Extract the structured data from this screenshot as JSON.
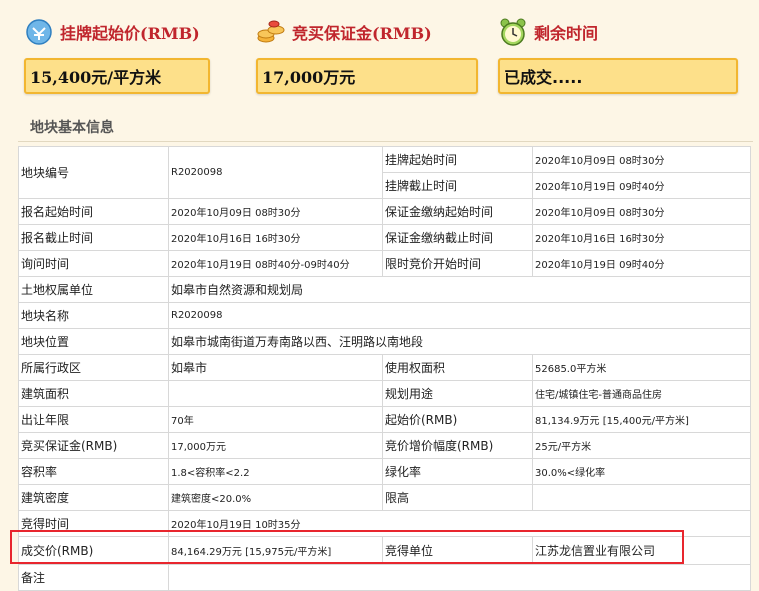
{
  "top": {
    "start_price_label": "挂牌起始价(RMB)",
    "start_price_value": "15,400元/平方米",
    "deposit_label": "竞买保证金(RMB)",
    "deposit_value": "17,000万元",
    "remaining_label": "剩余时间",
    "remaining_value": "已成交....."
  },
  "section_title": "地块基本信息",
  "rows": {
    "r1": {
      "l1": "地块编号",
      "v1": "R2020098",
      "l2a": "挂牌起始时间",
      "v2a": "2020年10月09日 08时30分",
      "l2b": "挂牌截止时间",
      "v2b": "2020年10月19日 09时40分"
    },
    "r2": {
      "l1": "报名起始时间",
      "v1": "2020年10月09日 08时30分",
      "l2": "保证金缴纳起始时间",
      "v2": "2020年10月09日 08时30分"
    },
    "r3": {
      "l1": "报名截止时间",
      "v1": "2020年10月16日 16时30分",
      "l2": "保证金缴纳截止时间",
      "v2": "2020年10月16日 16时30分"
    },
    "r4": {
      "l1": "询问时间",
      "v1": "2020年10月19日 08时40分-09时40分",
      "l2": "限时竞价开始时间",
      "v2": "2020年10月19日 09时40分"
    },
    "r5": {
      "l1": "土地权属单位",
      "v1": "如皋市自然资源和规划局"
    },
    "r6": {
      "l1": "地块名称",
      "v1": "R2020098"
    },
    "r7": {
      "l1": "地块位置",
      "v1": "如皋市城南街道万寿南路以西、汪明路以南地段"
    },
    "r8": {
      "l1": "所属行政区",
      "v1": "如皋市",
      "l2": "使用权面积",
      "v2": "52685.0平方米"
    },
    "r9": {
      "l1": "建筑面积",
      "v1": "",
      "l2": "规划用途",
      "v2": "住宅/城镇住宅-普通商品住房"
    },
    "r10": {
      "l1": "出让年限",
      "v1": "70年",
      "l2": "起始价(RMB)",
      "v2": "81,134.9万元 [15,400元/平方米]"
    },
    "r11": {
      "l1": "竞买保证金(RMB)",
      "v1": "17,000万元",
      "l2": "竞价增价幅度(RMB)",
      "v2": "25元/平方米"
    },
    "r12": {
      "l1": "容积率",
      "v1": "1.8<容积率<2.2",
      "l2": "绿化率",
      "v2": "30.0%<绿化率"
    },
    "r13": {
      "l1": "建筑密度",
      "v1": "建筑密度<20.0%",
      "l2": "限高",
      "v2": ""
    },
    "r14": {
      "l1": "竞得时间",
      "v1": "2020年10月19日 10时35分"
    },
    "r15": {
      "l1": "成交价(RMB)",
      "v1": "84,164.29万元 [15,975元/平方米]",
      "l2": "竞得单位",
      "v2": "江苏龙信置业有限公司"
    },
    "r16": {
      "l1": "备注",
      "v1": ""
    }
  },
  "colors": {
    "accent_red": "#c0262d",
    "value_box_fill": "#fde08a",
    "value_box_border": "#f2b630",
    "highlight_border": "#e8262e"
  },
  "icons": [
    "money-icon",
    "coins-icon",
    "alarm-clock-icon"
  ]
}
